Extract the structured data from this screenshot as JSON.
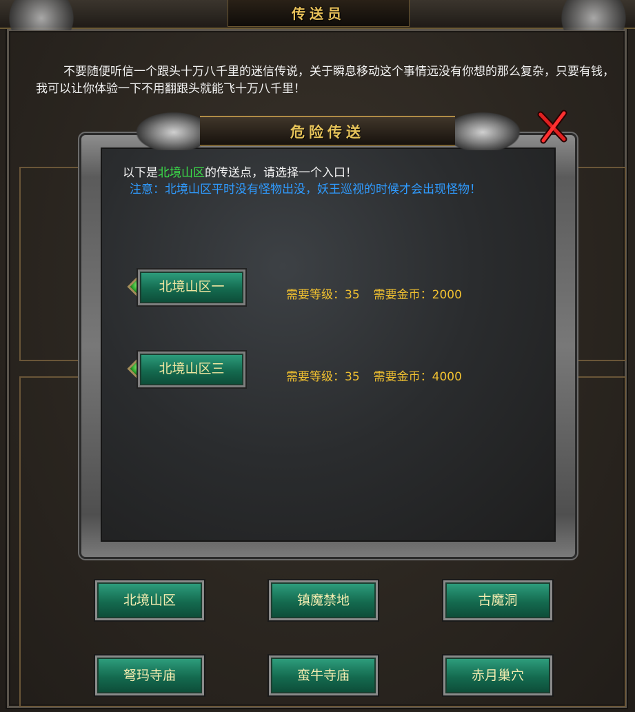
{
  "window": {
    "title": "传送员"
  },
  "intro_text": "不要随便听信一个跟头十万八千里的迷信传说，关于瞬息移动这个事情远没有你想的那么复杂，只要有钱，我可以让你体验一下不用翻跟头就能飞十万八千里！",
  "dialog": {
    "title": "危险传送",
    "line1_prefix": "以下是",
    "line1_highlight": "北境山区",
    "line1_suffix": "的传送点，请选择一个入口！",
    "notice": "注意：北境山区平时没有怪物出没，妖王巡视的时候才会出现怪物！",
    "entries": [
      {
        "label": "北境山区一",
        "level_req": "需要等级：35",
        "gold_req": "需要金币：2000"
      },
      {
        "label": "北境山区三",
        "level_req": "需要等级：35",
        "gold_req": "需要金币：4000"
      }
    ],
    "close_icon": "close-x-icon"
  },
  "maps": [
    {
      "label": "北境山区"
    },
    {
      "label": "镇魔禁地"
    },
    {
      "label": "古魔洞"
    },
    {
      "label": "弩玛寺庙"
    },
    {
      "label": "蛮牛寺庙"
    },
    {
      "label": "赤月巢穴"
    }
  ],
  "colors": {
    "title_gold": "#e6c35a",
    "highlight_green": "#3be04a",
    "notice_blue": "#2f9bff",
    "req_yellow": "#f0c030",
    "button_green": "#146a4f"
  }
}
